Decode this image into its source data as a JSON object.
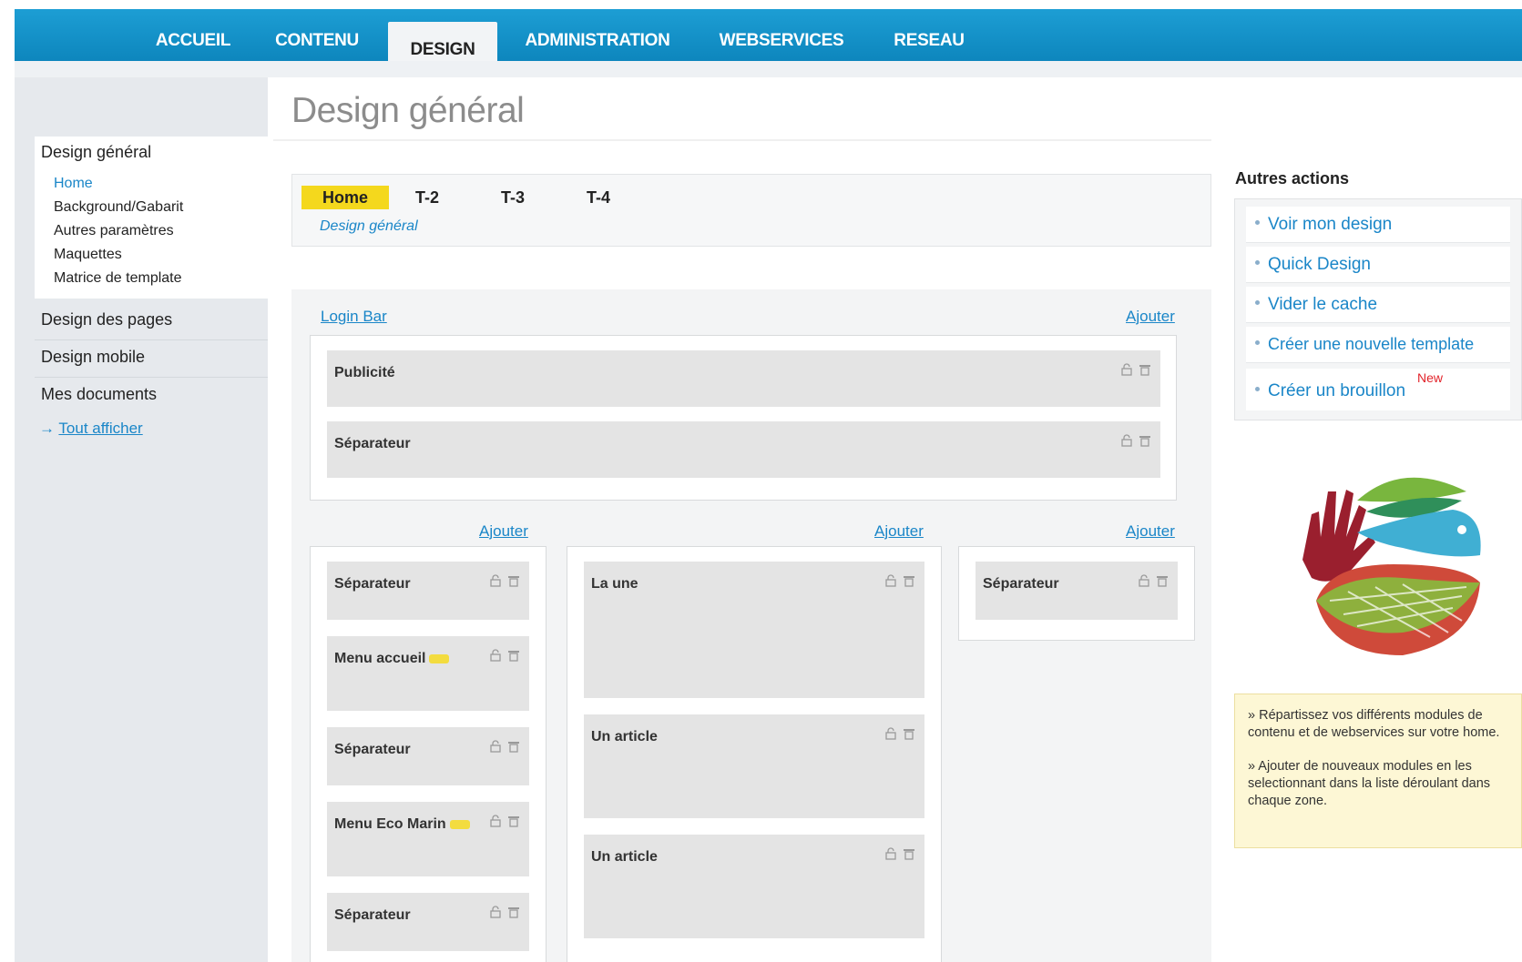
{
  "nav": {
    "tabs": [
      {
        "label": "ACCUEIL"
      },
      {
        "label": "CONTENU"
      },
      {
        "label": "DESIGN"
      },
      {
        "label": "ADMINISTRATION"
      },
      {
        "label": "WEBSERVICES"
      },
      {
        "label": "RESEAU"
      }
    ],
    "active": "DESIGN"
  },
  "sidebar": {
    "section1_title": "Design général",
    "section1_items": [
      "Home",
      "Background/Gabarit",
      "Autres paramètres",
      "Maquettes",
      "Matrice de template"
    ],
    "section2_title": "Design des pages",
    "section3_title": "Design mobile",
    "section4_title": "Mes documents",
    "show_all_arrow": "→",
    "show_all": "Tout afficher"
  },
  "main": {
    "page_title": "Design général",
    "template_tabs": [
      "Home",
      "T-2",
      "T-3",
      "T-4"
    ],
    "template_subtitle": "Design général",
    "login_bar": "Login Bar",
    "add_label": "Ajouter",
    "top_zone_modules": [
      "Publicité",
      "Séparateur"
    ],
    "left_zone_modules": [
      "Séparateur",
      "Menu accueil",
      "Séparateur",
      "Menu Eco Marin",
      "Séparateur"
    ],
    "center_zone_modules": [
      "La une",
      "Un article",
      "Un article"
    ],
    "right_zone_modules": [
      "Séparateur"
    ]
  },
  "right": {
    "actions_title": "Autres actions",
    "actions": [
      "Voir mon design",
      "Quick Design",
      "Vider le cache",
      "Créer une nouvelle template",
      "Créer un brouillon"
    ],
    "new_badge": "New",
    "tip1": "» Répartissez vos différents modules de contenu et de webservices sur votre home.",
    "tip2": "» Ajouter de nouveaux modules en les selectionnant dans la liste déroulant dans chaque zone."
  },
  "colors": {
    "nav_blue": "#1597cf",
    "link_blue": "#1a86c8",
    "highlight_yellow": "#f4d81d",
    "new_red": "#e2232a"
  }
}
